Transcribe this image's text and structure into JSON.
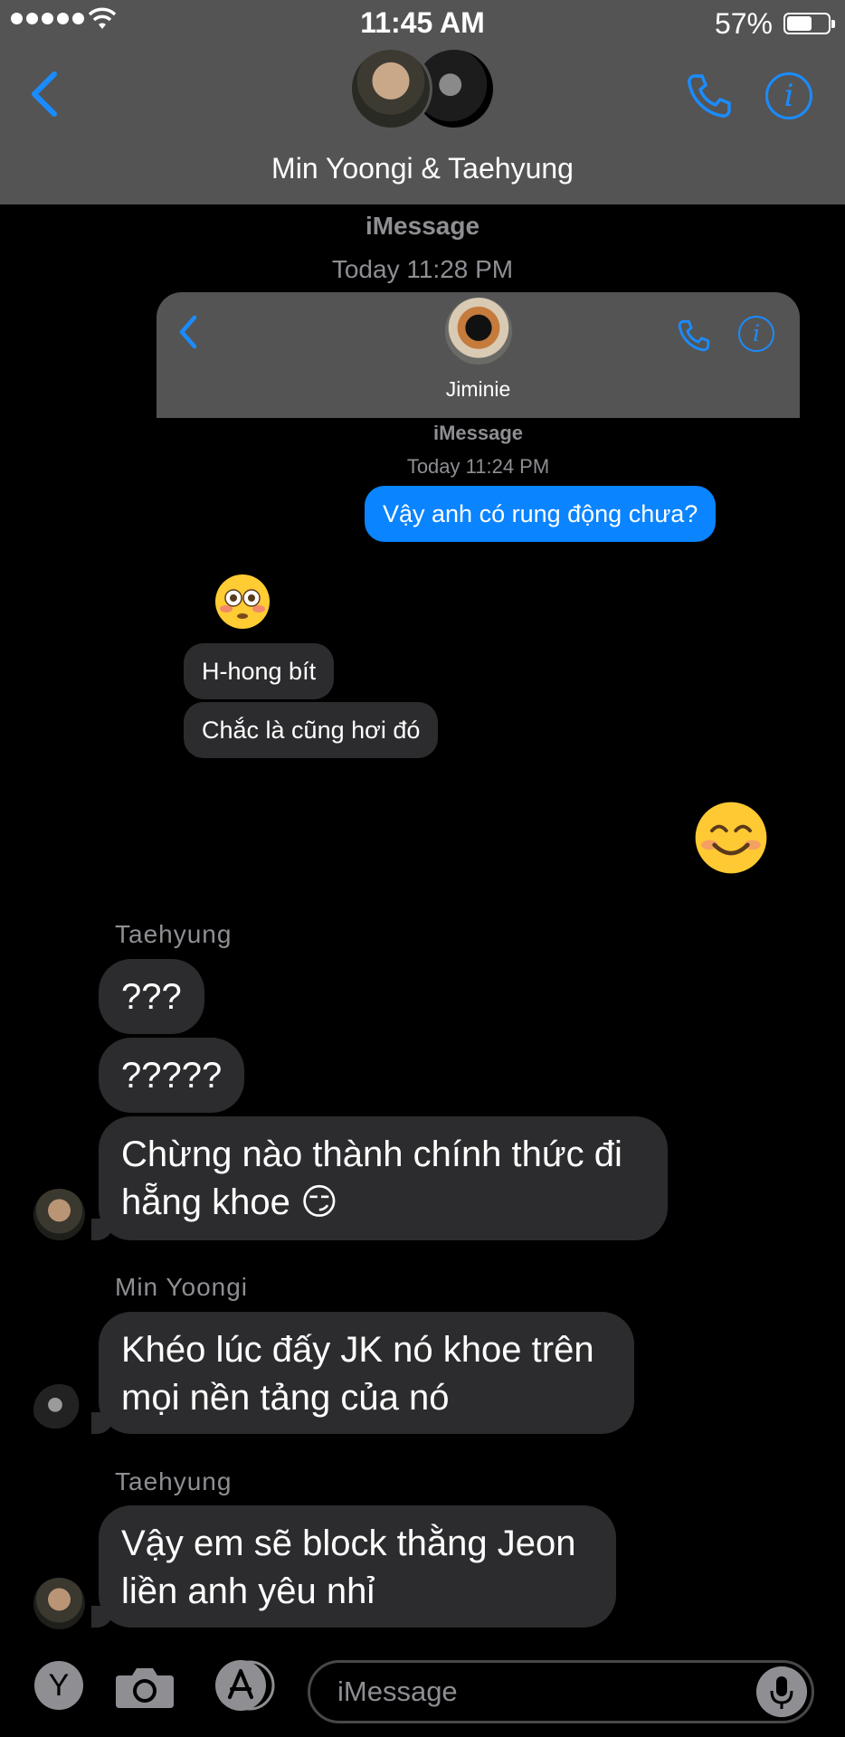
{
  "status_bar": {
    "time": "11:45 AM",
    "battery": "57%"
  },
  "header": {
    "title": "Min Yoongi & Taehyung"
  },
  "thread_meta": {
    "service": "iMessage",
    "timestamp": "Today 11:28 PM"
  },
  "embedded": {
    "contact_name": "Jiminie",
    "service": "iMessage",
    "timestamp": "Today 11:24 PM",
    "sent_message": "Vậy anh có rung động chưa?",
    "received_emoji": "😳",
    "received_messages": [
      "H-hong bít",
      "Chắc là cũng hơi đó"
    ]
  },
  "sent_emoji": "😊",
  "messages": [
    {
      "sender": "Taehyung",
      "lines": [
        "???"
      ]
    },
    {
      "lines": [
        "?????"
      ]
    },
    {
      "lines": [
        "Chừng nào thành chính thức đi",
        "hẵng khoe 😏"
      ]
    },
    {
      "sender": "Min Yoongi",
      "lines": [
        "Khéo lúc đấy JK nó khoe trên",
        "mọi nền tảng của nó"
      ]
    },
    {
      "sender": "Taehyung",
      "lines": [
        "Vậy em sẽ block thằng Jeon",
        "liền anh yêu nhỉ"
      ]
    }
  ],
  "input": {
    "placeholder": "iMessage"
  },
  "colors": {
    "accent": "#0a84ff",
    "header_bg": "#545454",
    "bubble_gray": "#2c2c2e"
  }
}
